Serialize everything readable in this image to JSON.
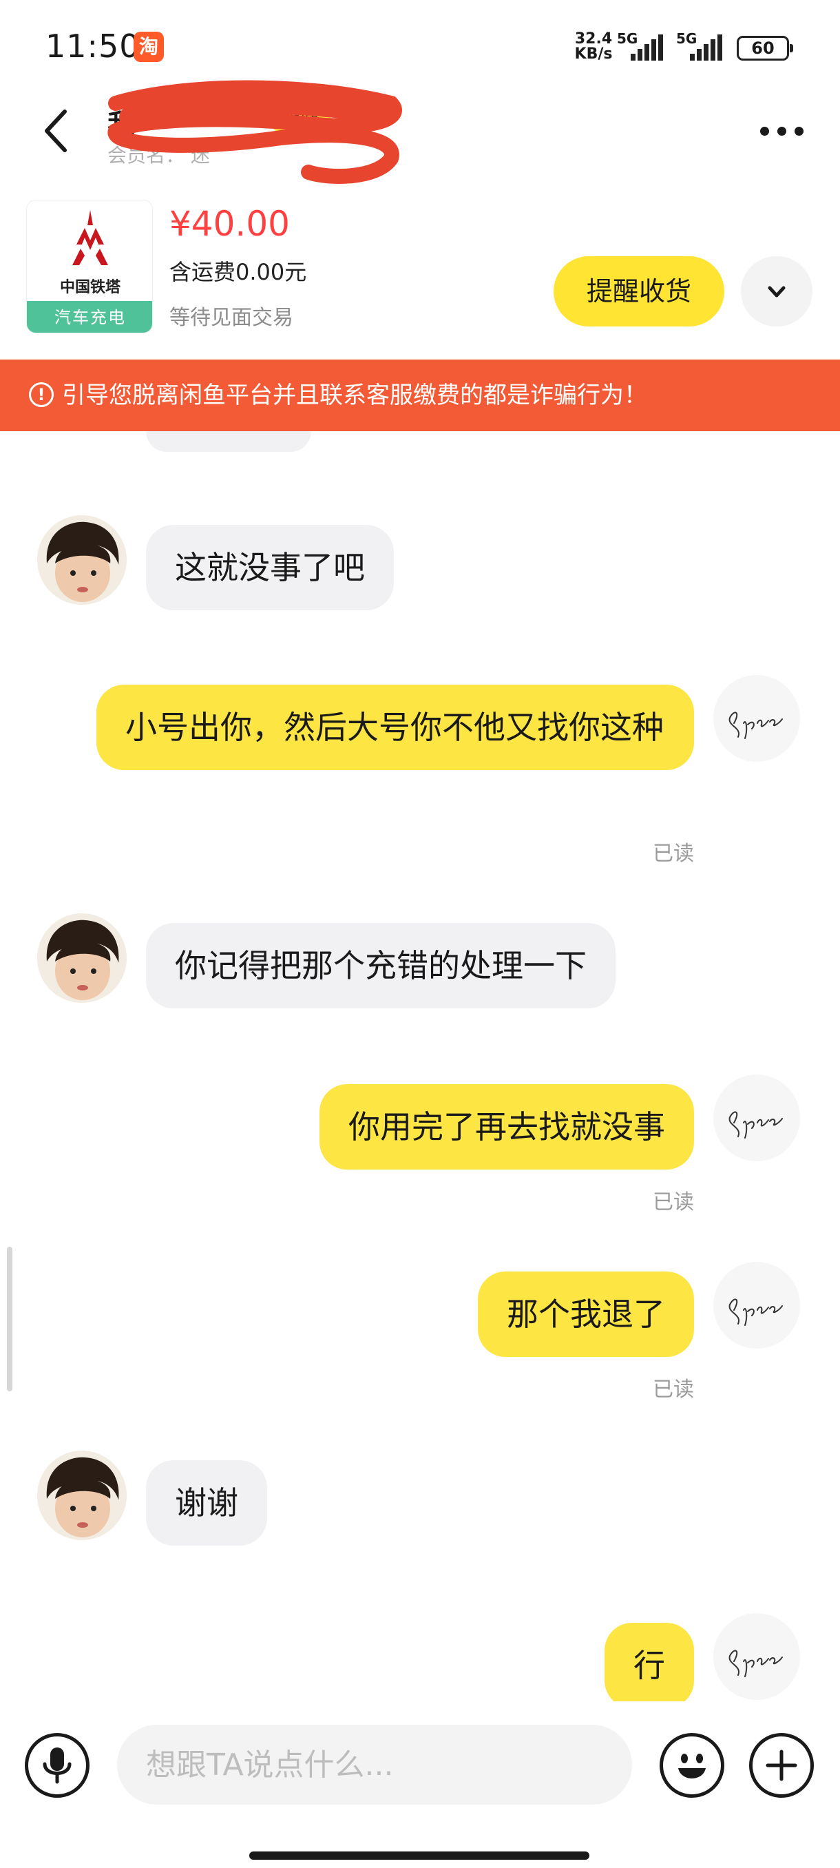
{
  "status_bar": {
    "time": "11:50",
    "app_badge": "淘",
    "net_speed_value": "32.4",
    "net_speed_unit": "KB/s",
    "sim1_label": "5G",
    "sim2_label": "5G",
    "battery": "60"
  },
  "header": {
    "title": "我",
    "tag": "极好",
    "subtitle": "会员名：   迷"
  },
  "product": {
    "brand": "中国铁塔",
    "banner": "汽车充电",
    "price": "¥40.00",
    "shipping": "含运费0.00元",
    "status": "等待见面交易",
    "remind_button": "提醒收货"
  },
  "warning": {
    "icon": "!",
    "text": "引导您脱离闲鱼平台并且联系客服缴费的都是诈骗行为！"
  },
  "messages": [
    {
      "from": "them",
      "text": "这就没事了吧"
    },
    {
      "from": "me",
      "text": "小号出你，然后大号你不他又找你这种",
      "status": "已读"
    },
    {
      "from": "them",
      "text": "你记得把那个充错的处理一下"
    },
    {
      "from": "me",
      "text": "你用完了再去找就没事",
      "status": "已读"
    },
    {
      "from": "me",
      "text": "那个我退了",
      "status": "已读"
    },
    {
      "from": "them",
      "text": "谢谢"
    },
    {
      "from": "me",
      "text": "行"
    }
  ],
  "my_avatar_signature": "Spanc",
  "input": {
    "placeholder": "想跟TA说点什么..."
  },
  "icons": {
    "voice": "microphone-icon",
    "emoji": "smile-icon",
    "plus": "plus-icon",
    "back": "chevron-left-icon",
    "more": "more-dots-icon",
    "expand": "chevron-down-icon"
  },
  "colors": {
    "accent_yellow": "#fde544",
    "price_red": "#ff4040",
    "warning_bg": "#f25b36",
    "incoming_bubble": "#f1f1f3"
  }
}
